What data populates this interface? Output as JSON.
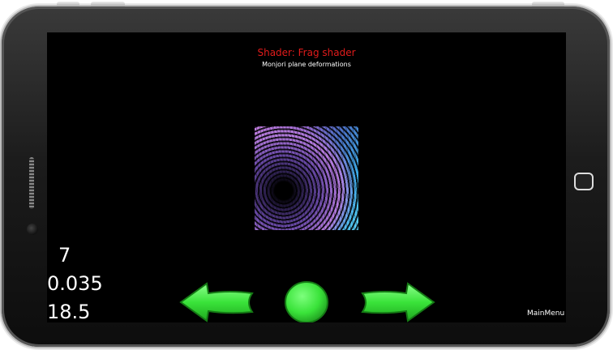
{
  "header": {
    "title": "Shader: Frag shader",
    "subtitle": "Monjori plane deformations"
  },
  "stats": {
    "line1": "7",
    "line2": "0.035",
    "line3": "18.5"
  },
  "navigation": {
    "main_menu_label": "MainMenu",
    "left_icon": "arrow-left-icon",
    "center_icon": "circle-play-icon",
    "right_icon": "arrow-right-icon"
  },
  "colors": {
    "title": "#e21b1b",
    "button_fill": "#3ae33a",
    "button_dark": "#1a8f1a",
    "screen_bg": "#000000"
  }
}
